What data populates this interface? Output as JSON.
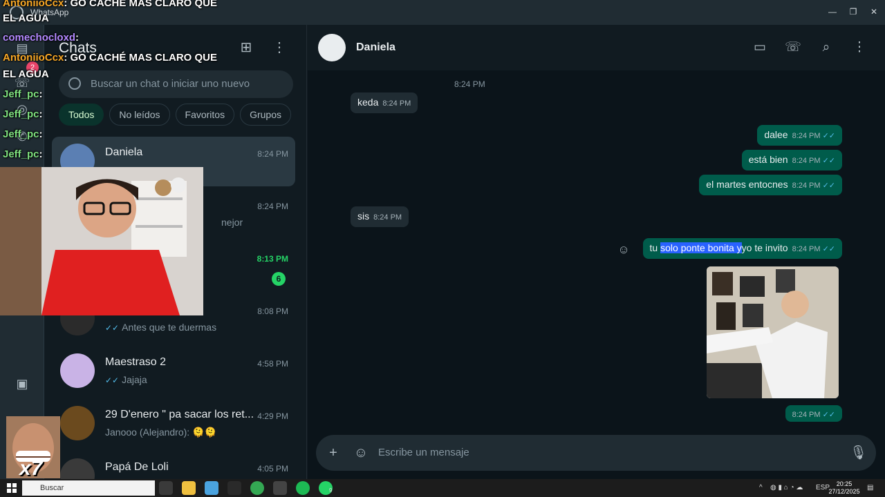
{
  "window": {
    "app_name": "WhatsApp",
    "controls": [
      "—",
      "❐",
      "✕"
    ]
  },
  "rail": {
    "chats_badge": "2"
  },
  "chat_list": {
    "title": "Chats",
    "search_placeholder": "Buscar un chat o iniciar uno nuevo",
    "filters": [
      "Todos",
      "No leídos",
      "Favoritos",
      "Grupos"
    ],
    "chats": [
      {
        "name": "Daniela",
        "time": "8:24 PM",
        "preview": ""
      },
      {
        "name": "",
        "time": "8:24 PM",
        "preview": "nejor"
      },
      {
        "name": "",
        "time": "8:13 PM",
        "preview": "",
        "unread": "6"
      },
      {
        "name": "",
        "time": "8:08 PM",
        "preview": "Antes que te duermas"
      },
      {
        "name": "Maestraso 2",
        "time": "4:58 PM",
        "preview": "Jajaja"
      },
      {
        "name": "29 D'enero \" pa sacar los ret...",
        "time": "4:29 PM",
        "preview": "Janooo (Alejandro): 🫠🫠"
      },
      {
        "name": "Papá De Loli",
        "time": "4:05 PM",
        "preview": ""
      }
    ]
  },
  "conversation": {
    "contact_name": "Daniela",
    "messages": [
      {
        "dir": "time",
        "time": "8:24 PM"
      },
      {
        "dir": "in",
        "text": "keda",
        "time": "8:24 PM"
      },
      {
        "dir": "out",
        "text": "dalee",
        "time": "8:24 PM"
      },
      {
        "dir": "out",
        "text": "está bien",
        "time": "8:24 PM"
      },
      {
        "dir": "out",
        "text": "el martes entocnes",
        "time": "8:24 PM"
      },
      {
        "dir": "in",
        "text": "sis",
        "time": "8:24 PM"
      },
      {
        "dir": "out",
        "text_pre": "tu ",
        "text_sel": "solo ponte bonita y",
        "text_post": "yo te invito",
        "time": "8:24 PM"
      },
      {
        "dir": "out-image",
        "time": "8:24 PM"
      }
    ],
    "composer_placeholder": "Escribe un mensaje"
  },
  "stream_chat": [
    {
      "user": "AntoniioCcx",
      "text": ": GO CACHÉ MAS CLARO QUE",
      "cont": "EL AGUA"
    },
    {
      "user": "comechocloxd",
      "text": ":"
    },
    {
      "user": "AntoniioCcx",
      "text": ": GO CACHÉ MAS CLARO QUE",
      "cont": "EL AGUA"
    },
    {
      "user": "Jeff_pc",
      "text": ":"
    },
    {
      "user": "Jeff_pc",
      "text": ":"
    },
    {
      "user": "Jeff_pc",
      "text": ":"
    },
    {
      "user": "Jeff_pc",
      "text": ":"
    }
  ],
  "meme_multiplier": "x7",
  "taskbar": {
    "search_label": "Buscar",
    "language": "ESP",
    "clock_time": "20:25",
    "clock_date": "27/12/2025",
    "whatsapp_badge": "9"
  },
  "colors": {
    "accent": "#25d366",
    "outgoing_bubble": "#005c4b",
    "incoming_bubble": "#202c33",
    "read_ticks": "#53bdeb"
  }
}
